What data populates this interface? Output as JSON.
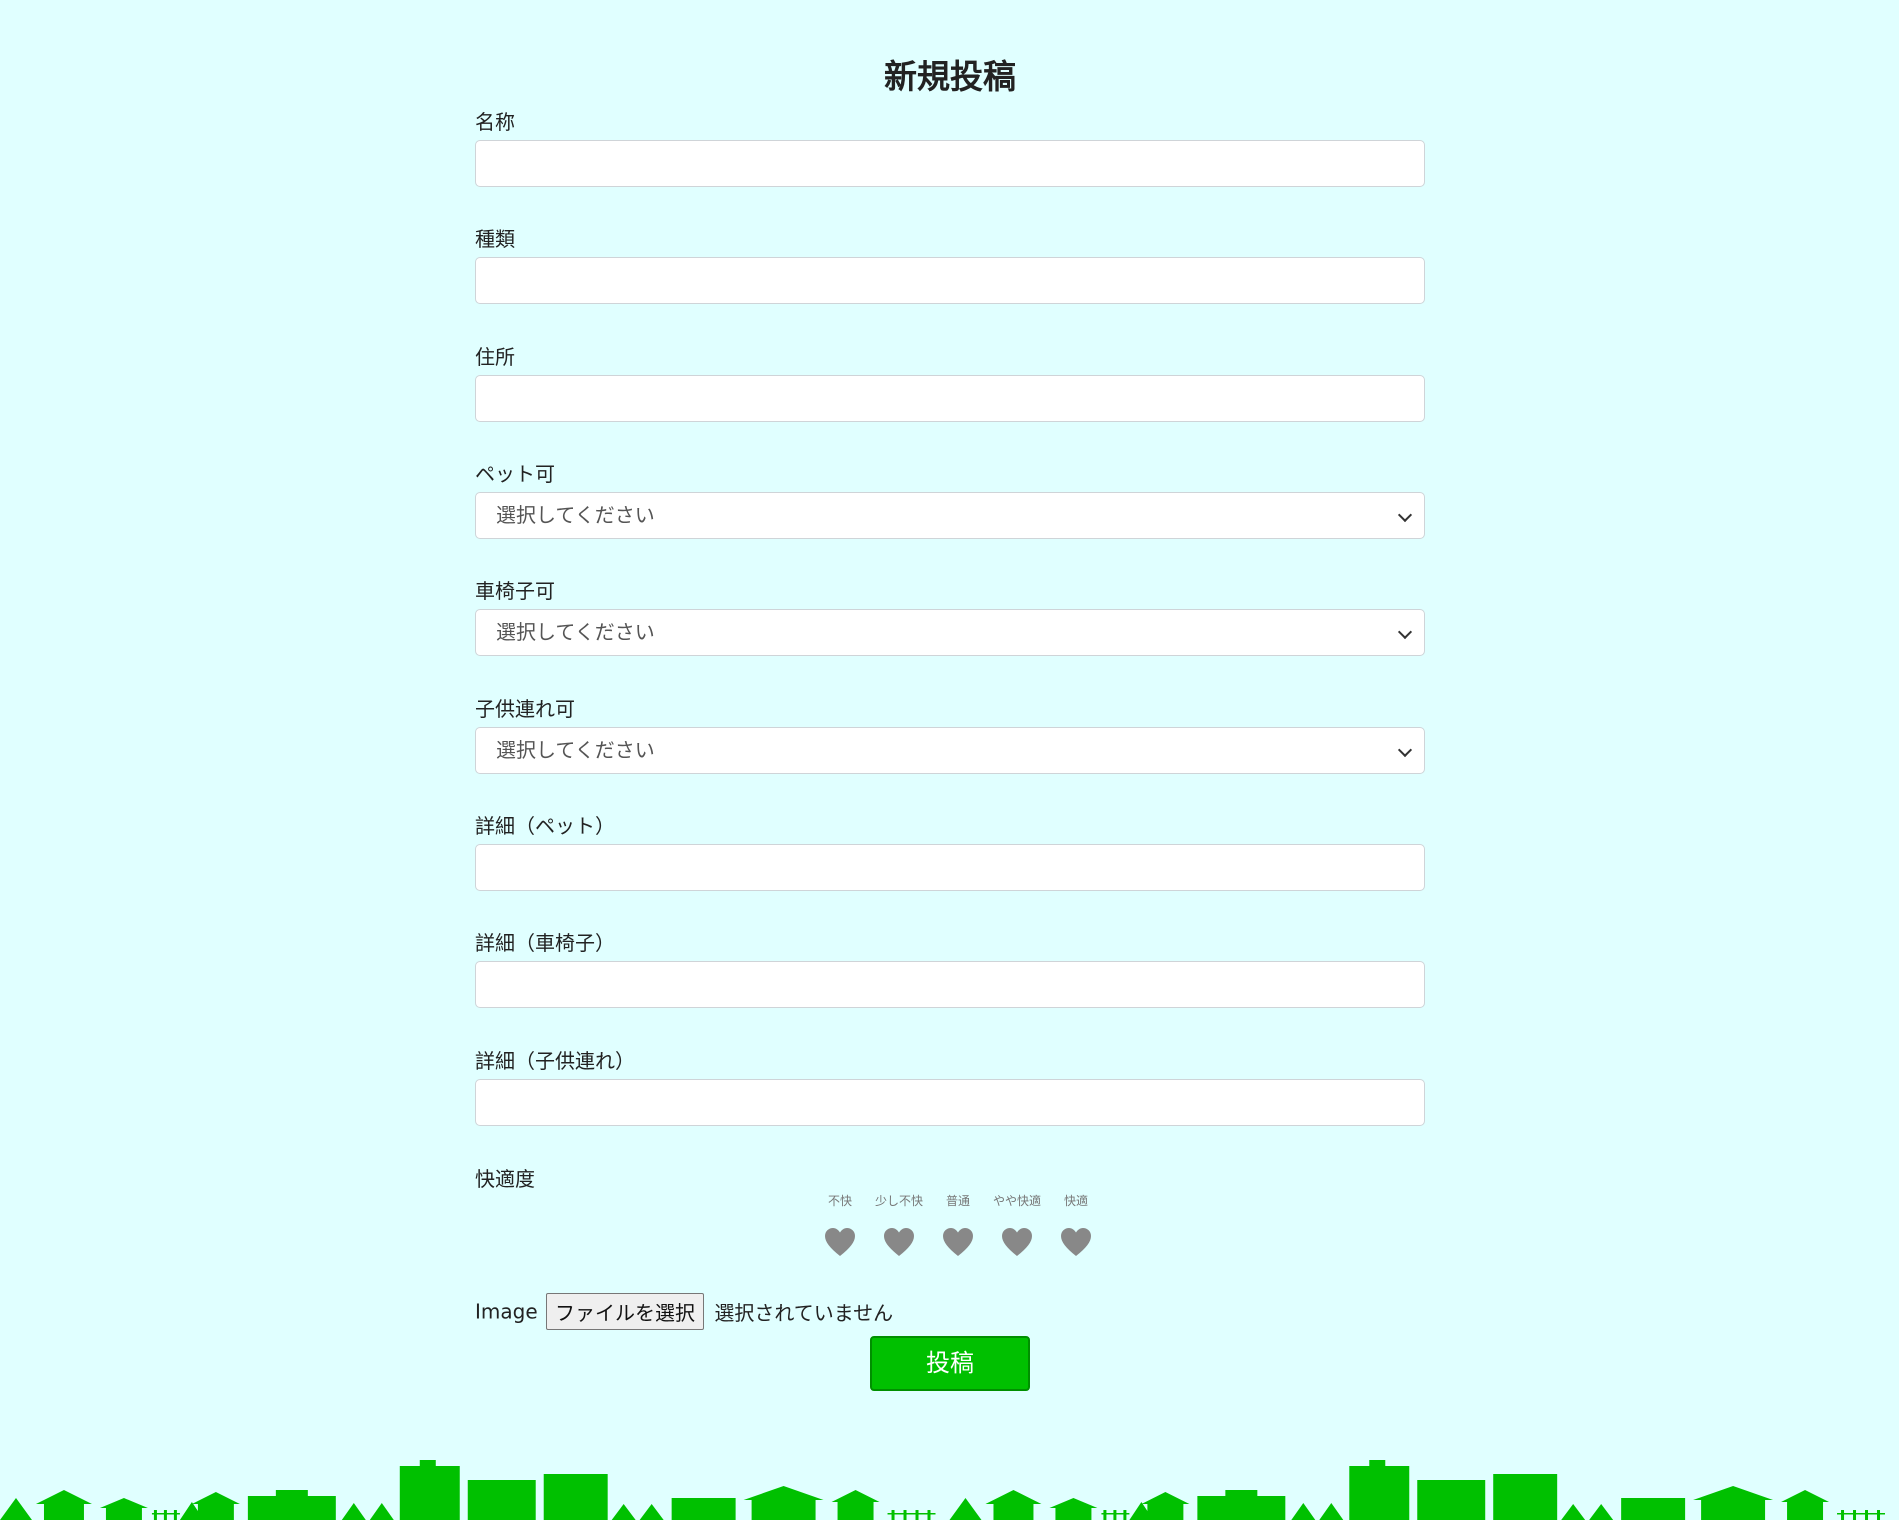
{
  "page": {
    "title": "新規投稿",
    "accent_color": "#00c000",
    "background_color": "#e0ffff"
  },
  "fields": [
    {
      "label": "名称",
      "type": "text",
      "value": ""
    },
    {
      "label": "種類",
      "type": "text",
      "value": ""
    },
    {
      "label": "住所",
      "type": "text",
      "value": ""
    },
    {
      "label": "ペット可",
      "type": "select",
      "selected": "選択してください"
    },
    {
      "label": "車椅子可",
      "type": "select",
      "selected": "選択してください"
    },
    {
      "label": "子供連れ可",
      "type": "select",
      "selected": "選択してください"
    },
    {
      "label": "詳細（ペット）",
      "type": "text",
      "value": ""
    },
    {
      "label": "詳細（車椅子）",
      "type": "text",
      "value": ""
    },
    {
      "label": "詳細（子供連れ）",
      "type": "text",
      "value": ""
    }
  ],
  "rating": {
    "label": "快適度",
    "levels": [
      "不快",
      "少し不快",
      "普通",
      "やや快適",
      "快適"
    ],
    "selected": 0,
    "icon": "heart-icon",
    "inactive_color": "#888888"
  },
  "image_upload": {
    "label": "Image",
    "button_label": "ファイルを選択",
    "status": "選択されていません"
  },
  "submit": {
    "label": "投稿"
  },
  "footer": {
    "decoration": "town-skyline",
    "color": "#00c000"
  }
}
